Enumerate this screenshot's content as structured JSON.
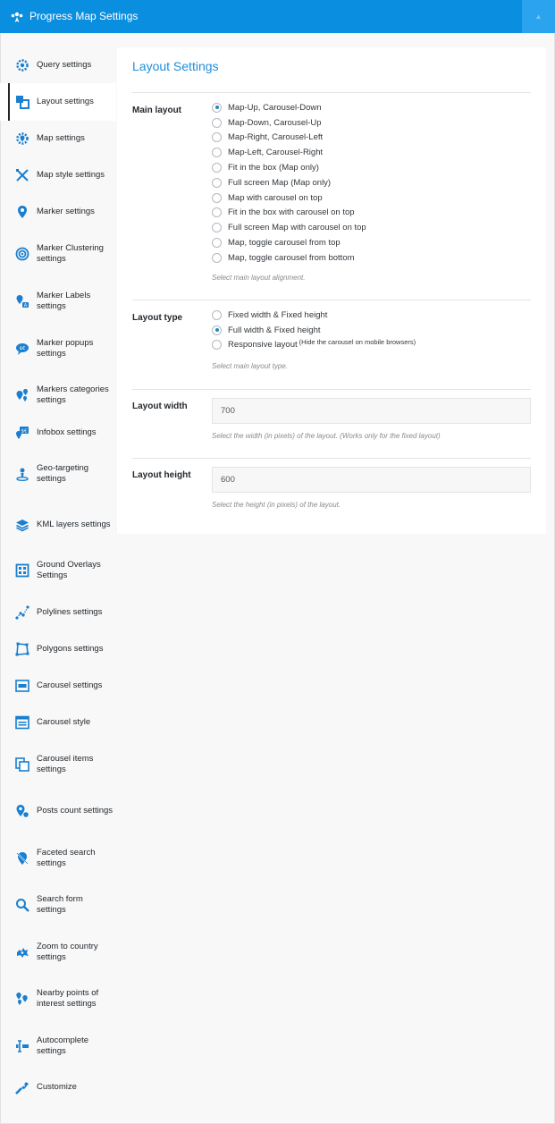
{
  "app": {
    "title": "Progress Map Settings",
    "accent_color": "#0a8fe0"
  },
  "sidebar": {
    "items": [
      {
        "label": "Query settings",
        "icon": "gear-icon"
      },
      {
        "label": "Layout settings",
        "icon": "layout-icon",
        "active": true
      },
      {
        "label": "Map settings",
        "icon": "map-gear-icon"
      },
      {
        "label": "Map style settings",
        "icon": "map-style-icon"
      },
      {
        "label": "Marker settings",
        "icon": "marker-icon"
      },
      {
        "label": "Marker Clustering settings",
        "icon": "cluster-icon"
      },
      {
        "label": "Marker Labels settings",
        "icon": "marker-label-icon"
      },
      {
        "label": "Marker popups settings",
        "icon": "popup-icon"
      },
      {
        "label": "Markers categories settings",
        "icon": "categories-icon"
      },
      {
        "label": "Infobox settings",
        "icon": "infobox-icon"
      },
      {
        "label": "Geo-targeting settings",
        "icon": "geo-target-icon"
      },
      {
        "label": "KML layers settings",
        "icon": "layers-icon"
      },
      {
        "label": "Ground Overlays Settings",
        "icon": "ground-overlay-icon"
      },
      {
        "label": "Polylines settings",
        "icon": "polyline-icon"
      },
      {
        "label": "Polygons settings",
        "icon": "polygon-icon"
      },
      {
        "label": "Carousel settings",
        "icon": "carousel-icon"
      },
      {
        "label": "Carousel style",
        "icon": "carousel-style-icon"
      },
      {
        "label": "Carousel items settings",
        "icon": "carousel-items-icon"
      },
      {
        "label": "Posts count settings",
        "icon": "posts-count-icon"
      },
      {
        "label": "Faceted search settings",
        "icon": "faceted-search-icon"
      },
      {
        "label": "Search form settings",
        "icon": "search-icon"
      },
      {
        "label": "Zoom to country settings",
        "icon": "zoom-country-icon"
      },
      {
        "label": "Nearby points of interest settings",
        "icon": "nearby-poi-icon"
      },
      {
        "label": "Autocomplete settings",
        "icon": "autocomplete-icon"
      },
      {
        "label": "Customize",
        "icon": "customize-icon"
      }
    ]
  },
  "main": {
    "title": "Layout Settings",
    "main_layout": {
      "label": "Main layout",
      "options": [
        "Map-Up, Carousel-Down",
        "Map-Down, Carousel-Up",
        "Map-Right, Carousel-Left",
        "Map-Left, Carousel-Right",
        "Fit in the box (Map only)",
        "Full screen Map (Map only)",
        "Map with carousel on top",
        "Fit in the box with carousel on top",
        "Full screen Map with carousel on top",
        "Map, toggle carousel from top",
        "Map, toggle carousel from bottom"
      ],
      "selected": "Map-Up, Carousel-Down",
      "help": "Select main layout alignment."
    },
    "layout_type": {
      "label": "Layout type",
      "options": [
        "Fixed width & Fixed height",
        "Full width & Fixed height",
        "Responsive layout"
      ],
      "responsive_note": "(Hide the carousel on mobile browsers)",
      "selected": "Full width & Fixed height",
      "help": "Select main layout type."
    },
    "layout_width": {
      "label": "Layout width",
      "value": "700",
      "help": "Select the width (in pixels) of the layout. (Works only for the fixed layout)"
    },
    "layout_height": {
      "label": "Layout height",
      "value": "600",
      "help": "Select the height (in pixels) of the layout."
    }
  }
}
